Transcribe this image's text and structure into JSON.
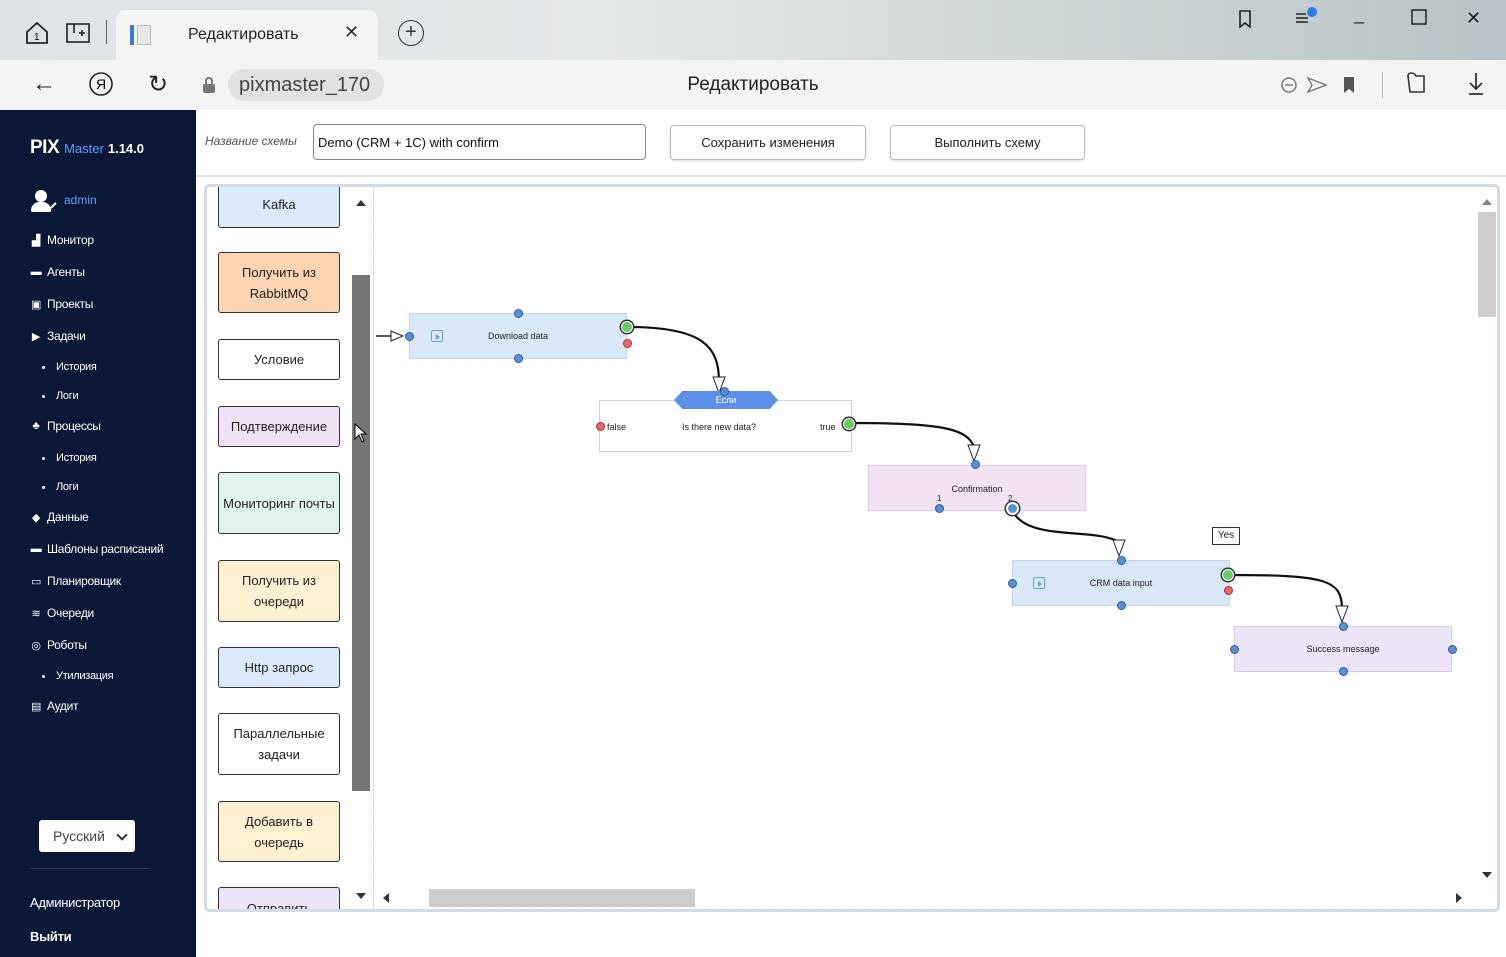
{
  "browser": {
    "tab_title": "Редактировать",
    "url": "pixmaster_170",
    "page_title": "Редактировать"
  },
  "sidebar": {
    "logo": "PIX",
    "logo_sub": "Master",
    "version": "1.14.0",
    "user": "admin",
    "items": [
      {
        "label": "Монитор",
        "icon": "bar-chart-icon",
        "sub": false
      },
      {
        "label": "Агенты",
        "icon": "monitor-icon",
        "sub": false
      },
      {
        "label": "Проекты",
        "icon": "project-icon",
        "sub": false
      },
      {
        "label": "Задачи",
        "icon": "play-box-icon",
        "sub": false
      },
      {
        "label": "История",
        "icon": "dot-icon",
        "sub": true
      },
      {
        "label": "Логи",
        "icon": "dot-icon",
        "sub": true
      },
      {
        "label": "Процессы",
        "icon": "process-icon",
        "sub": false
      },
      {
        "label": "История",
        "icon": "dot-icon",
        "sub": true
      },
      {
        "label": "Логи",
        "icon": "dot-icon",
        "sub": true
      },
      {
        "label": "Данные",
        "icon": "diamond-icon",
        "sub": false
      },
      {
        "label": "Шаблоны расписаний",
        "icon": "calendar-icon",
        "sub": false
      },
      {
        "label": "Планировщик",
        "icon": "scheduler-icon",
        "sub": false
      },
      {
        "label": "Очереди",
        "icon": "layers-icon",
        "sub": false
      },
      {
        "label": "Роботы",
        "icon": "robot-icon",
        "sub": false
      },
      {
        "label": "Утилизация",
        "icon": "dot-icon",
        "sub": true
      },
      {
        "label": "Аудит",
        "icon": "audit-icon",
        "sub": false
      }
    ],
    "language": "Русский",
    "footer_admin": "Администратор",
    "footer_logout": "Выйти"
  },
  "form": {
    "name_label": "Название схемы",
    "name_value": "Demo (CRM + 1C) with confirm",
    "save_label": "Сохранить изменения",
    "run_label": "Выполнить схему"
  },
  "palette": [
    {
      "label": "Kafka",
      "color": "#dcebfb"
    },
    {
      "label": "Получить из RabbitMQ",
      "color": "#fdd5b4"
    },
    {
      "label": "Условие",
      "color": "#ffffff"
    },
    {
      "label": "Подтверждение",
      "color": "#f2e2f6"
    },
    {
      "label": "Мониторинг почты",
      "color": "#e2f5ec"
    },
    {
      "label": "Получить из очереди",
      "color": "#fff1d1"
    },
    {
      "label": "Http запрос",
      "color": "#dcebfb"
    },
    {
      "label": "Параллельные задачи",
      "color": "#ffffff"
    },
    {
      "label": "Добавить в очередь",
      "color": "#fff1d1"
    },
    {
      "label": "Отправить",
      "color": "#ece6f8"
    }
  ],
  "flow": {
    "download": "Download data",
    "condition_tag": "Если",
    "condition_false": "false",
    "condition_text": "Is there new data?",
    "condition_true": "true",
    "confirmation": "Confirmation",
    "confirm_port1": "1",
    "confirm_port2": "2",
    "yes_label": "Yes",
    "crm": "CRM data input",
    "success": "Success message"
  },
  "colors": {
    "sidebar_bg": "#0b1737",
    "accent": "#5aa0ff",
    "task_node": "#d9e9fa",
    "confirm_node": "#f3e3f5",
    "success_node": "#ece6f8",
    "if_tag": "#5b8fe8"
  }
}
